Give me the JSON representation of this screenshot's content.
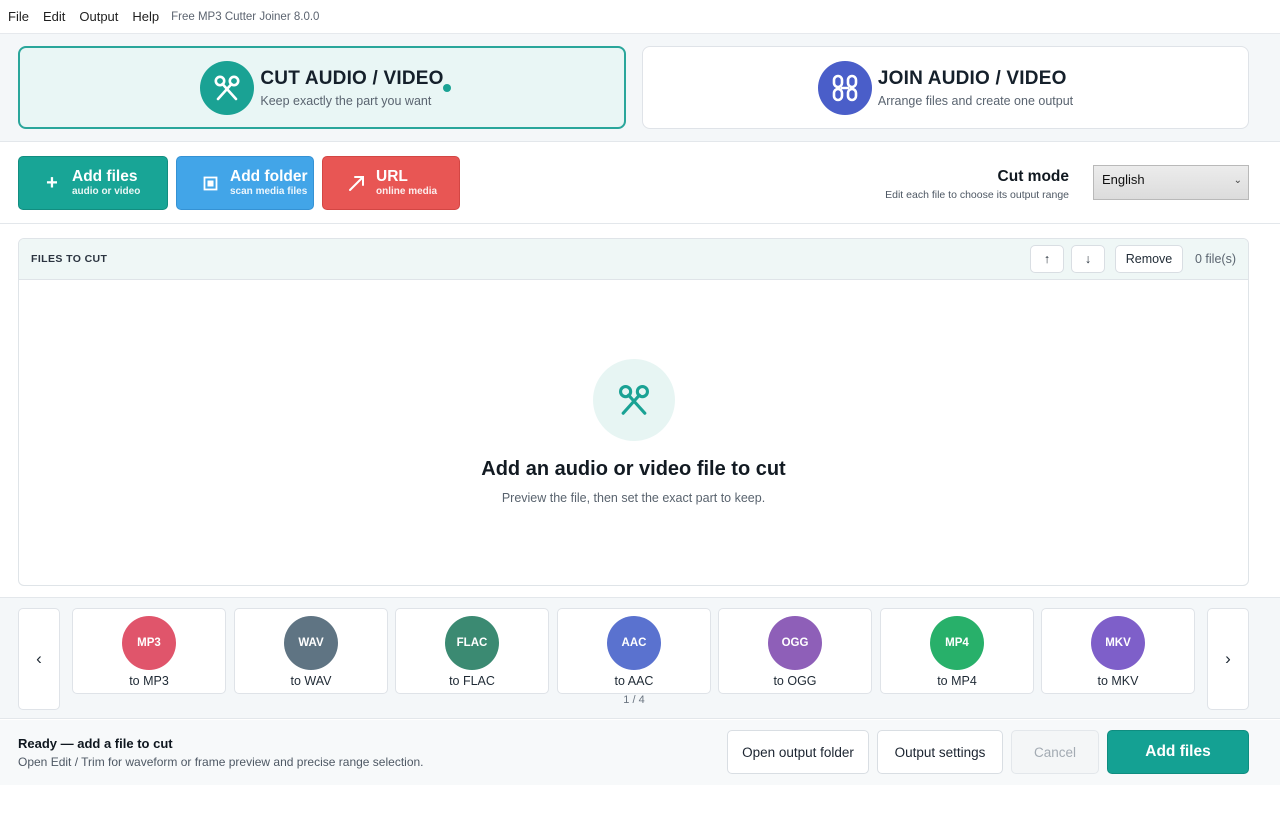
{
  "menubar": {
    "items": [
      "File",
      "Edit",
      "Output",
      "Help"
    ],
    "app_title": "Free MP3 Cutter Joiner 8.0.0"
  },
  "modes": {
    "cut": {
      "title": "CUT AUDIO / VIDEO",
      "subtitle": "Keep exactly the part you want",
      "icon": "scissors-icon",
      "active": true
    },
    "join": {
      "title": "JOIN AUDIO / VIDEO",
      "subtitle": "Arrange files and create one output",
      "icon": "chain-link-icon",
      "active": false
    }
  },
  "toolbar": {
    "add_files": {
      "label": "Add files",
      "sub": "audio or video",
      "icon": "plus-icon"
    },
    "add_folder": {
      "label": "Add folder",
      "sub": "scan media files",
      "icon": "folder-icon"
    },
    "url": {
      "label": "URL",
      "sub": "online media",
      "icon": "arrow-up-right-icon"
    },
    "cut_mode_title": "Cut mode",
    "cut_mode_hint": "Edit each file to choose its output range",
    "language_selected": "English"
  },
  "files_panel": {
    "title": "FILES TO CUT",
    "up_label": "↑",
    "down_label": "↓",
    "remove_label": "Remove",
    "count": "0 file(s)",
    "empty_title": "Add an audio or video file to cut",
    "empty_sub": "Preview the file, then set the exact part to keep."
  },
  "formats": {
    "prev_label": "‹",
    "next_label": "›",
    "page": "1 / 4",
    "items": [
      {
        "badge": "MP3",
        "label": "to MP3",
        "color": "#e0556b"
      },
      {
        "badge": "WAV",
        "label": "to WAV",
        "color": "#5f7483"
      },
      {
        "badge": "FLAC",
        "label": "to FLAC",
        "color": "#3b8a72"
      },
      {
        "badge": "AAC",
        "label": "to AAC",
        "color": "#5a72cf"
      },
      {
        "badge": "OGG",
        "label": "to OGG",
        "color": "#8e5fb8"
      },
      {
        "badge": "MP4",
        "label": "to MP4",
        "color": "#28b06a"
      },
      {
        "badge": "MKV",
        "label": "to MKV",
        "color": "#7e5fc9"
      }
    ]
  },
  "status": {
    "title": "Ready — add a file to cut",
    "sub": "Open Edit / Trim for waveform or frame preview and precise range selection.",
    "open_output_folder": "Open output folder",
    "output_settings": "Output settings",
    "cancel": "Cancel",
    "add_files": "Add files"
  },
  "colors": {
    "accent_teal": "#1aa294",
    "join_blue": "#4a5ec9",
    "folder_blue": "#42a5e8",
    "url_red": "#e85654"
  }
}
